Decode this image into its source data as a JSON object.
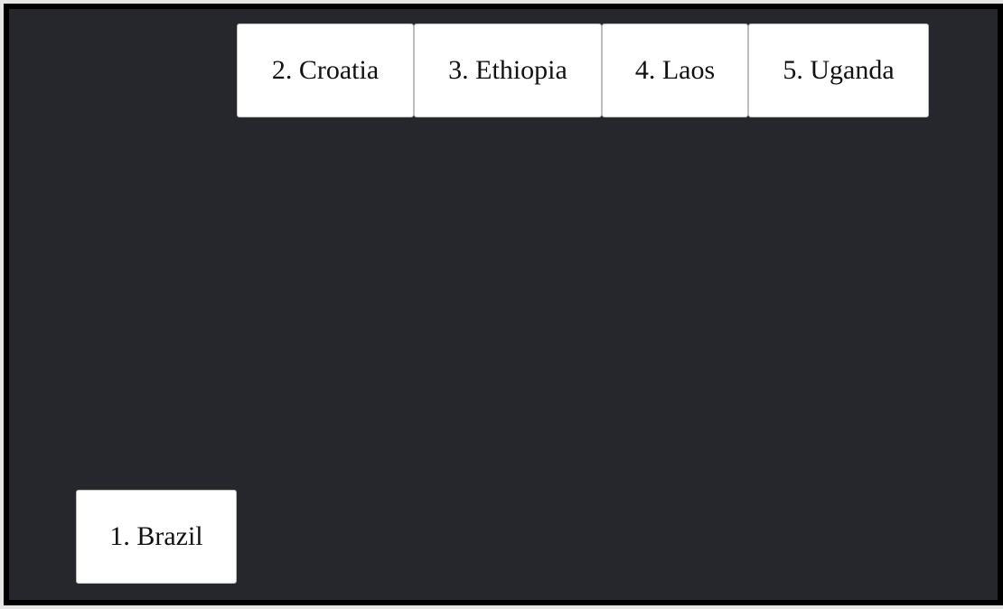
{
  "tiles": [
    {
      "id": "brazil",
      "label": "1. Brazil"
    },
    {
      "id": "croatia",
      "label": "2. Croatia"
    },
    {
      "id": "ethiopia",
      "label": "3. Ethiopia"
    },
    {
      "id": "laos",
      "label": "4. Laos"
    },
    {
      "id": "uganda",
      "label": "5. Uganda"
    }
  ],
  "colors": {
    "canvas_background": "#26262d",
    "canvas_border": "#000000",
    "tile_background": "#ffffff",
    "tile_border": "#bdbdbd",
    "tile_text": "#111111"
  }
}
